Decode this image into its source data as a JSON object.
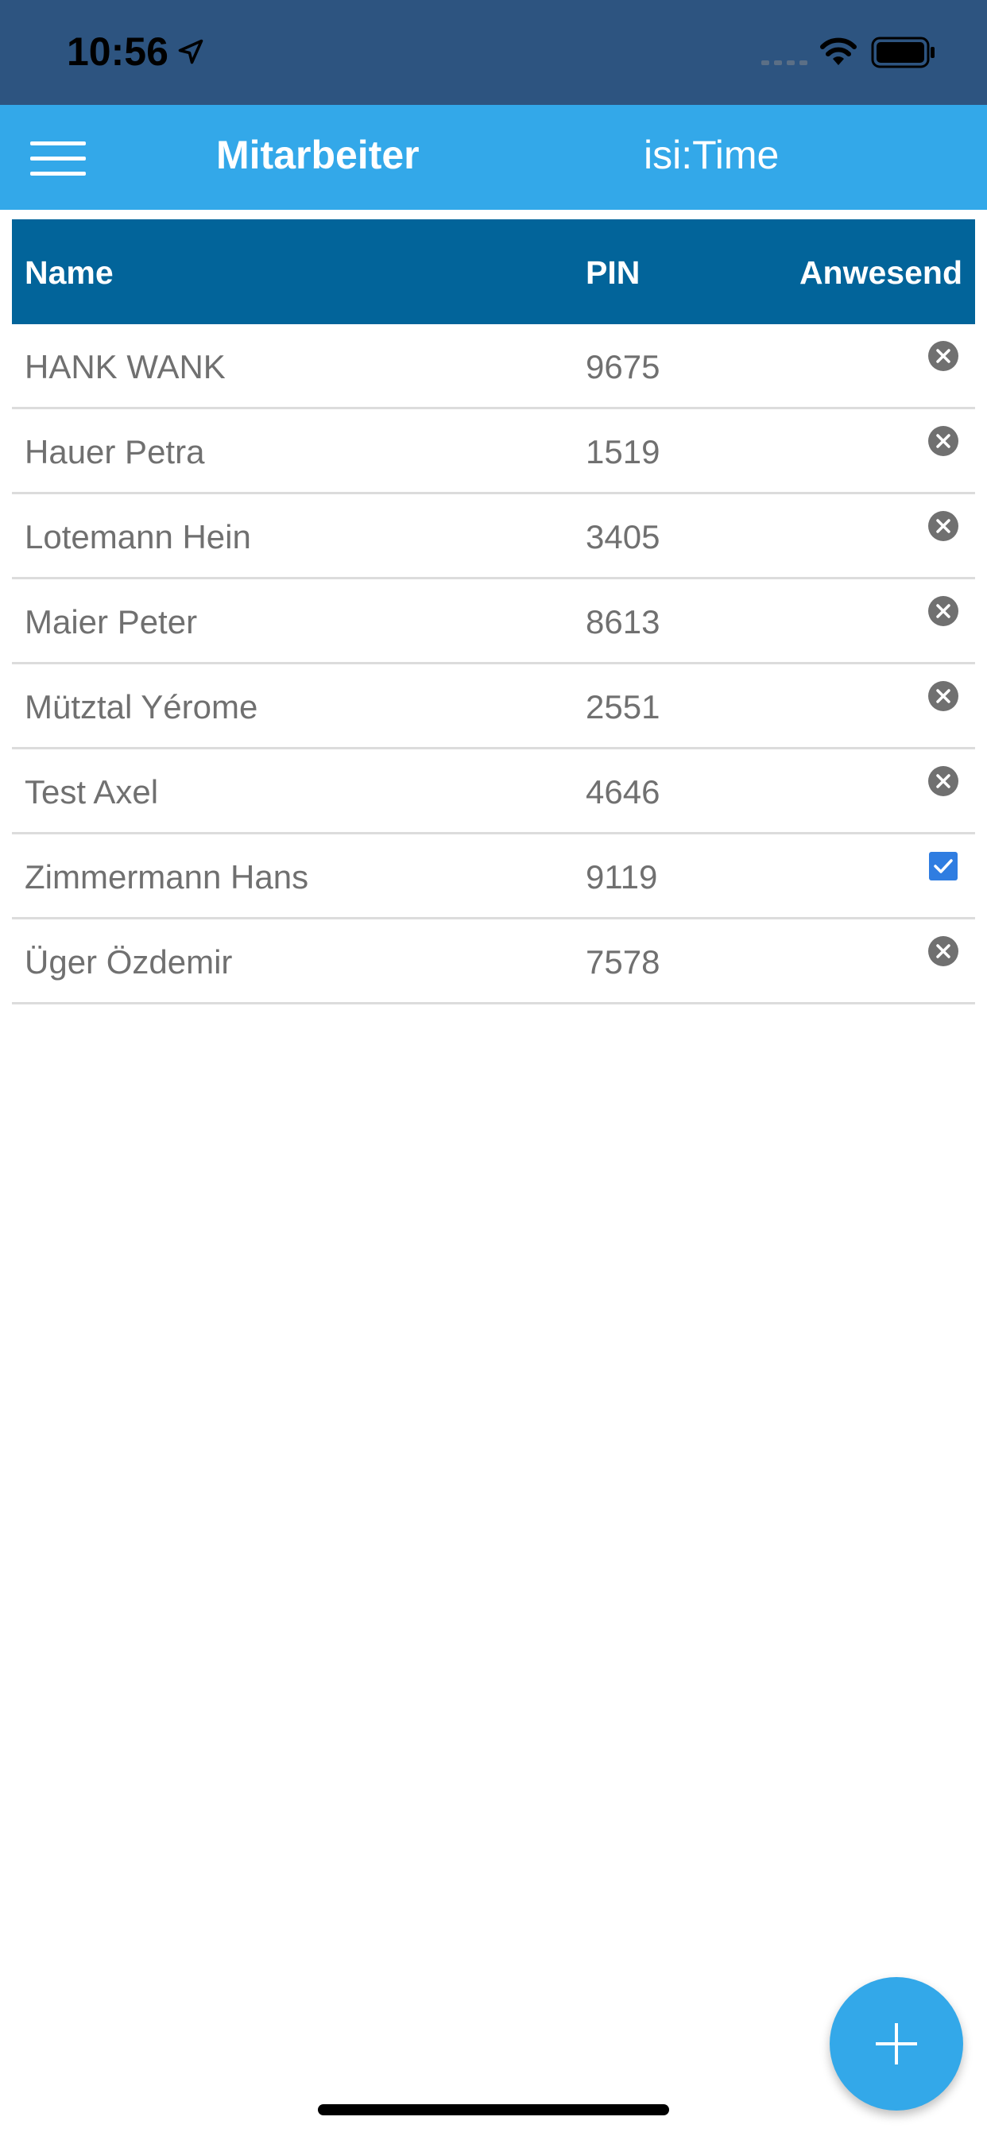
{
  "status_bar": {
    "time": "10:56",
    "icons": [
      "location-arrow-icon",
      "cellular-signal-icon",
      "wifi-icon",
      "battery-icon"
    ]
  },
  "app_bar": {
    "title": "Mitarbeiter",
    "brand": "isi:Time",
    "menu_icon": "hamburger-menu-icon"
  },
  "table": {
    "headers": {
      "name": "Name",
      "pin": "PIN",
      "present": "Anwesend"
    },
    "rows": [
      {
        "name": "HANK WANK",
        "pin": "9675",
        "present": false
      },
      {
        "name": "Hauer Petra",
        "pin": "1519",
        "present": false
      },
      {
        "name": "Lotemann Hein",
        "pin": "3405",
        "present": false
      },
      {
        "name": "Maier Peter",
        "pin": "8613",
        "present": false
      },
      {
        "name": "Mütztal Yérome",
        "pin": "2551",
        "present": false
      },
      {
        "name": "Test Axel",
        "pin": "4646",
        "present": false
      },
      {
        "name": "Zimmermann Hans",
        "pin": "9119",
        "present": true
      },
      {
        "name": "Üger Özdemir",
        "pin": "7578",
        "present": false
      }
    ]
  },
  "fab": {
    "icon": "plus-icon"
  },
  "colors": {
    "status_bar": "#2d5480",
    "app_bar": "#33a8e9",
    "table_header": "#02649a",
    "absent_icon": "#707070",
    "present_checkbox": "#2f7de1"
  }
}
